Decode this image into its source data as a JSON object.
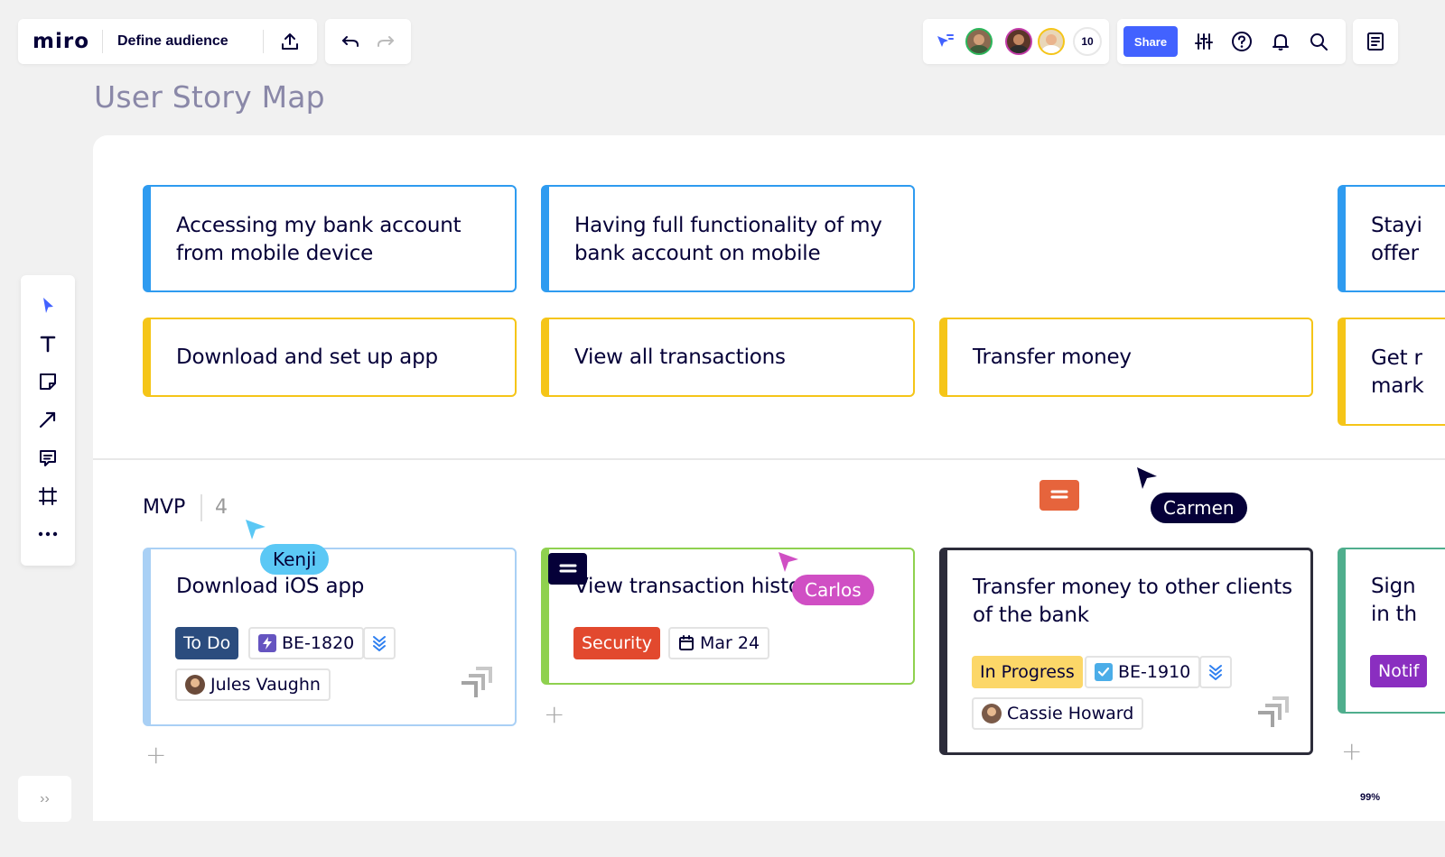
{
  "topbar": {
    "logo": "miro",
    "board_name": "Define audience",
    "share_label": "Share",
    "collaborator_count": "10"
  },
  "page_title": "User Story Map",
  "activities": [
    {
      "text_line1": "Accessing my bank account",
      "text_line2": "from mobile device"
    },
    {
      "text_line1": "Having full functionality of my",
      "text_line2": "bank account on mobile"
    },
    {
      "text_line1": "Stayi",
      "text_line2": "offer"
    }
  ],
  "tasks": [
    {
      "text": "Download and set up app"
    },
    {
      "text": "View all transactions"
    },
    {
      "text": "Transfer money"
    },
    {
      "text_line1": "Get r",
      "text_line2": "mark"
    }
  ],
  "release": {
    "label": "MVP",
    "count": "4"
  },
  "stories": [
    {
      "title": "Download iOS app",
      "status": "To Do",
      "ticket": "BE-1820",
      "assignee": "Jules Vaughn"
    },
    {
      "title": "View transaction history",
      "label": "Security",
      "date": "Mar 24"
    },
    {
      "title_line1": "Transfer money to other clients",
      "title_line2": "of the bank",
      "status": "In Progress",
      "ticket": "BE-1910",
      "assignee": "Cassie Howard"
    },
    {
      "title_line1": "Sign",
      "title_line2": "in th",
      "tag": "Notif"
    }
  ],
  "cursors": [
    {
      "name": "Kenji",
      "color": "#5bc8f5"
    },
    {
      "name": "Carlos",
      "color": "#d04fc4"
    },
    {
      "name": "Carmen",
      "color": "#050038"
    }
  ],
  "zoom": "99%",
  "colors": {
    "accent": "#4262ff",
    "activity_border": "#2e9bf0",
    "task_border": "#f5c518",
    "todo_bg": "#2b4c7e",
    "security_bg": "#e2492e",
    "inprogress_bg": "#fcd768",
    "notif_bg": "#8a2ec0"
  }
}
